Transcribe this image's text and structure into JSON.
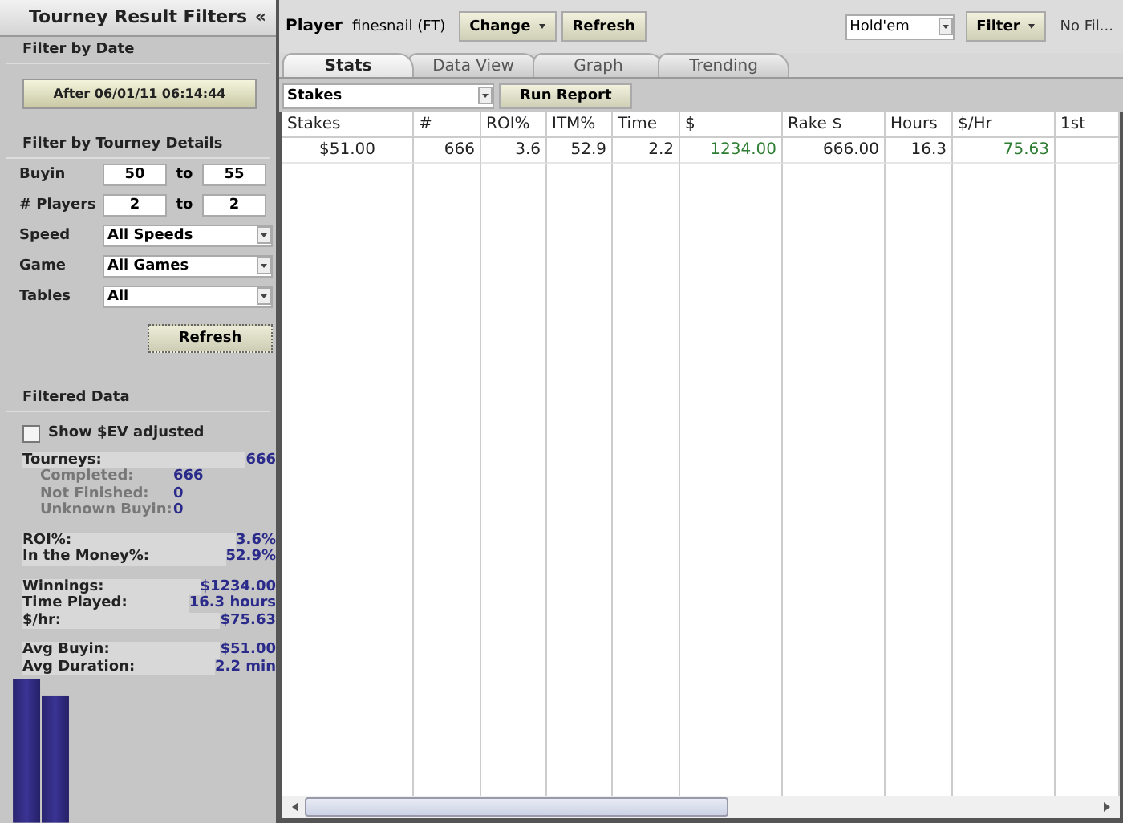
{
  "sidebar": {
    "title": "Tourney Result Filters",
    "collapse": "«",
    "date_section": {
      "heading": "Filter by Date",
      "button": "After 06/01/11 06:14:44"
    },
    "details_section": {
      "heading": "Filter by Tourney Details",
      "ranges": [
        {
          "label": "Buyin",
          "from": "50",
          "sep": "to",
          "to": "55"
        },
        {
          "label": "# Players",
          "from": "2",
          "sep": "to",
          "to": "2"
        }
      ],
      "selects": [
        {
          "label": "Speed",
          "value": "All Speeds"
        },
        {
          "label": "Game",
          "value": "All Games"
        },
        {
          "label": "Tables",
          "value": "All"
        }
      ],
      "button": "Refresh"
    },
    "filtered": {
      "heading": "Filtered Data",
      "checkbox": {
        "label": "Show $EV adjusted",
        "checked": false
      },
      "groups": [
        [
          {
            "label": "Tourneys:",
            "value": "666",
            "kind": "main"
          },
          {
            "label": "Completed:",
            "value": "666",
            "kind": "sub"
          },
          {
            "label": "Not Finished:",
            "value": "0",
            "kind": "sub"
          },
          {
            "label": "Unknown Buyin:",
            "value": "0",
            "kind": "sub"
          }
        ],
        [
          {
            "label": "ROI%:",
            "value": "3.6%",
            "kind": "main"
          },
          {
            "label": "In the Money%:",
            "value": "52.9%",
            "kind": "main"
          }
        ],
        [
          {
            "label": "Winnings:",
            "value": "$1234.00",
            "kind": "main"
          },
          {
            "label": "Time Played:",
            "value": "16.3 hours",
            "kind": "main"
          },
          {
            "label": "$/hr:",
            "value": "$75.63",
            "kind": "main"
          }
        ],
        [
          {
            "label": "Avg Buyin:",
            "value": "$51.00",
            "kind": "main"
          },
          {
            "label": "Avg Duration:",
            "value": "2.2 min",
            "kind": "main"
          }
        ]
      ]
    }
  },
  "topbar": {
    "label": "Player",
    "player": "finesnail (FT)",
    "change": "Change",
    "refresh": "Refresh",
    "game": "Hold'em",
    "filter": "Filter",
    "filter_status": "No Fil..."
  },
  "tabs": [
    {
      "label": "Stats",
      "selected": true
    },
    {
      "label": "Data View",
      "selected": false
    },
    {
      "label": "Graph",
      "selected": false
    },
    {
      "label": "Trending",
      "selected": false
    }
  ],
  "report": {
    "select": "Stakes",
    "button": "Run Report"
  },
  "table": {
    "columns": [
      {
        "label": "Stakes",
        "kind": "center"
      },
      {
        "label": "#",
        "kind": "number"
      },
      {
        "label": "ROI%",
        "kind": "number"
      },
      {
        "label": "ITM%",
        "kind": "number"
      },
      {
        "label": "Time",
        "kind": "number"
      },
      {
        "label": "$",
        "kind": "gain"
      },
      {
        "label": "Rake $",
        "kind": "number"
      },
      {
        "label": "Hours",
        "kind": "number"
      },
      {
        "label": "$/Hr",
        "kind": "gain"
      },
      {
        "label": "1st",
        "kind": "number"
      }
    ],
    "rows": [
      [
        "$51.00",
        "666",
        "3.6",
        "52.9",
        "2.2",
        "1234.00",
        "666.00",
        "16.3",
        "75.63",
        ""
      ]
    ]
  }
}
